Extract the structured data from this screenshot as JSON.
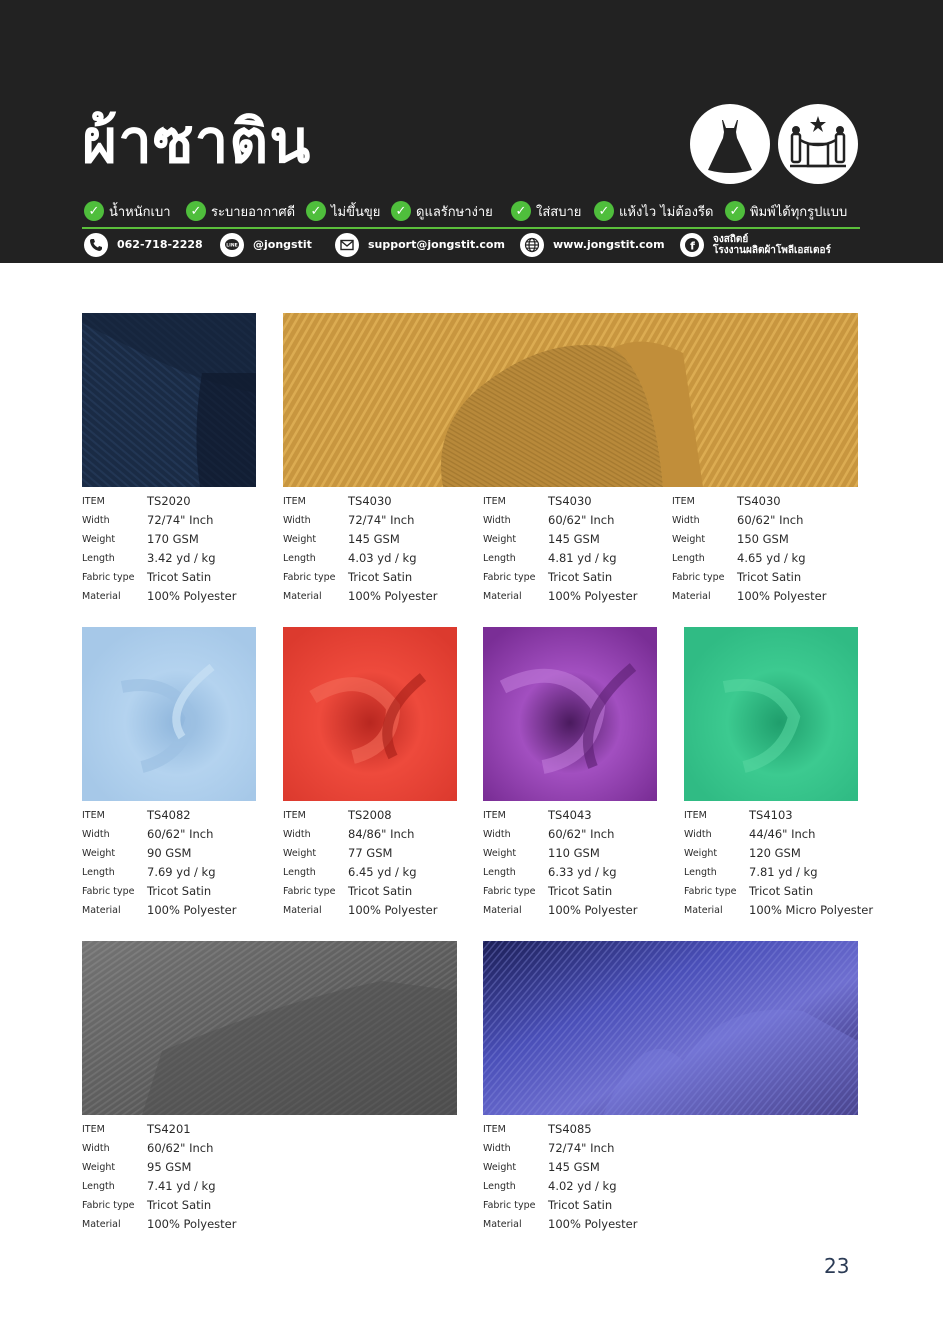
{
  "header": {
    "title": "ผ้าซาติน",
    "features": [
      "น้ำหนักเบา",
      "ระบายอากาศดี",
      "ไม่ขึ้นขุย",
      "ดูแลรักษาง่าย",
      "ใส่สบาย",
      "แห้งไว ไม่ต้องรีด",
      "พิมพ์ได้ทุกรูปแบบ"
    ],
    "contacts": {
      "phone": "062-718-2228",
      "line": "@jongstit",
      "email": "support@jongstit.com",
      "website": "www.jongstit.com",
      "facebook_line1": "จงสถิตย์",
      "facebook_line2": "โรงงานผลิตผ้าโพลีเอสเตอร์"
    },
    "icons": [
      "dress-icon",
      "award-stage-icon",
      "check-icon",
      "phone-icon",
      "line-icon",
      "mail-icon",
      "globe-icon",
      "facebook-icon"
    ]
  },
  "spec_labels": [
    "ITEM",
    "Width",
    "Weight",
    "Length",
    "Fabric type",
    "Material"
  ],
  "fabrics": [
    {
      "item": "TS2020",
      "width": "72/74\" Inch",
      "weight": "170 GSM",
      "length": "3.42 yd / kg",
      "fabric_type": "Tricot Satin",
      "material": "100% Polyester",
      "color": "#1a2b45"
    },
    {
      "item": "TS4030",
      "width": "72/74\" Inch",
      "weight": "145 GSM",
      "length": "4.03 yd / kg",
      "fabric_type": "Tricot Satin",
      "material": "100% Polyester",
      "color": "#c8963f"
    },
    {
      "item": "TS4030",
      "width": "60/62\" Inch",
      "weight": "145 GSM",
      "length": "4.81 yd / kg",
      "fabric_type": "Tricot Satin",
      "material": "100% Polyester",
      "color": "#c8963f"
    },
    {
      "item": "TS4030",
      "width": "60/62\" Inch",
      "weight": "150 GSM",
      "length": "4.65 yd / kg",
      "fabric_type": "Tricot Satin",
      "material": "100% Polyester",
      "color": "#c8963f"
    },
    {
      "item": "TS4082",
      "width": "60/62\" Inch",
      "weight": "90 GSM",
      "length": "7.69 yd / kg",
      "fabric_type": "Tricot Satin",
      "material": "100% Polyester",
      "color": "#a8cbea"
    },
    {
      "item": "TS2008",
      "width": "84/86\" Inch",
      "weight": "77 GSM",
      "length": "6.45 yd / kg",
      "fabric_type": "Tricot Satin",
      "material": "100% Polyester",
      "color": "#e23a30"
    },
    {
      "item": "TS4043",
      "width": "60/62\" Inch",
      "weight": "110 GSM",
      "length": "6.33 yd / kg",
      "fabric_type": "Tricot Satin",
      "material": "100% Polyester",
      "color": "#8a3aa6"
    },
    {
      "item": "TS4103",
      "width": "44/46\" Inch",
      "weight": "120 GSM",
      "length": "7.81 yd / kg",
      "fabric_type": "Tricot Satin",
      "material": "100% Micro Polyester",
      "color": "#2fbf86"
    },
    {
      "item": "TS4201",
      "width": "60/62\" Inch",
      "weight": "95 GSM",
      "length": "7.41 yd / kg",
      "fabric_type": "Tricot Satin",
      "material": "100% Polyester",
      "color": "#6a6a6a"
    },
    {
      "item": "TS4085",
      "width": "72/74\" Inch",
      "weight": "145 GSM",
      "length": "4.02 yd / kg",
      "fabric_type": "Tricot Satin",
      "material": "100% Polyester",
      "color": "#3e3f9a"
    }
  ],
  "page_number": "23"
}
